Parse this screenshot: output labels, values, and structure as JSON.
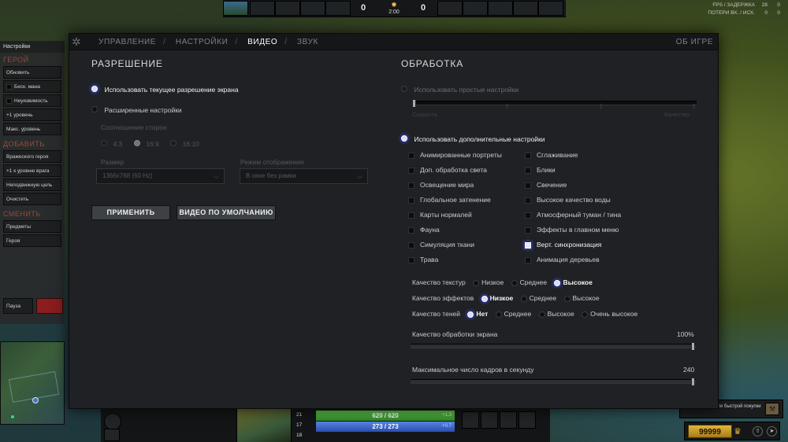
{
  "hud": {
    "score_radiant": "0",
    "score_dire": "0",
    "clock": "2:00",
    "fps_label": "FPS / ЗАДЕРЖКА",
    "fps_value": "28",
    "fps_latency": "0",
    "loss_label": "ПОТЕРИ ВХ. / ИСХ.",
    "loss_in": "0",
    "loss_out": "0",
    "hp": "620 / 620",
    "hp_regen": "+1.3",
    "mana": "273 / 273",
    "mana_regen": "+0.7",
    "attr_str": "21",
    "attr_agi": "17",
    "attr_int": "18",
    "gold": "99999",
    "quickbuy_text": "…те предмет для быстрой покупки"
  },
  "cheats": {
    "title": "Настройки",
    "hero_section": "ГЕРОЙ",
    "hero_buttons": [
      "Обновить",
      "Беск. мана",
      "Неуязвимость",
      "+1 уровень",
      "Макс. уровень"
    ],
    "add_section": "ДОБАВИТЬ",
    "add_buttons": [
      "Вражеского героя",
      "+1 к уровню врага",
      "Неподвижную цель",
      "Очистить"
    ],
    "change_section": "СМЕНИТЬ",
    "change_buttons": [
      "Предметы",
      "Героя"
    ],
    "pause": "Пауза"
  },
  "dialog": {
    "tabs": [
      "УПРАВЛЕНИЕ",
      "НАСТРОЙКИ",
      "ВИДЕО",
      "ЗВУК"
    ],
    "active_tab": "ВИДЕО",
    "about": "ОБ ИГРЕ",
    "resolution": {
      "title": "РАЗРЕШЕНИЕ",
      "use_current": "Использовать текущее разрешение экрана",
      "advanced": "Расширенные настройки",
      "aspect_label": "Соотношение сторон",
      "aspect_options": [
        "4:3",
        "16:9",
        "16:10"
      ],
      "aspect_selected": "16:9",
      "size_label": "Размер",
      "size_value": "1366x768 (60 Hz)",
      "mode_label": "Режим отображения",
      "mode_value": "В окне без рамки",
      "apply": "ПРИМЕНИТЬ",
      "default": "ВИДЕО ПО УМОЛЧАНИЮ"
    },
    "rendering": {
      "title": "ОБРАБОТКА",
      "simple": "Использовать простые настройки",
      "speed": "Скорость",
      "quality": "Качество",
      "advanced": "Использовать дополнительные настройки",
      "options_left": [
        {
          "label": "Анимированные портреты",
          "checked": false
        },
        {
          "label": "Доп. обработка света",
          "checked": false
        },
        {
          "label": "Освещение мира",
          "checked": false
        },
        {
          "label": "Глобальное затенение",
          "checked": false
        },
        {
          "label": "Карты нормалей",
          "checked": false
        },
        {
          "label": "Фауна",
          "checked": false
        },
        {
          "label": "Симуляция ткани",
          "checked": false
        },
        {
          "label": "Трава",
          "checked": false
        }
      ],
      "options_right": [
        {
          "label": "Сглаживание",
          "checked": false
        },
        {
          "label": "Блики",
          "checked": false
        },
        {
          "label": "Свечение",
          "checked": false
        },
        {
          "label": "Высокое качество воды",
          "checked": false
        },
        {
          "label": "Атмосферный туман / тина",
          "checked": false
        },
        {
          "label": "Эффекты в главном меню",
          "checked": false
        },
        {
          "label": "Верт. синхронизация",
          "checked": true
        },
        {
          "label": "Анимация деревьев",
          "checked": false
        }
      ],
      "texture_label": "Качество текстур",
      "texture_options": [
        "Низкое",
        "Среднее",
        "Высокое"
      ],
      "texture_selected": "Высокое",
      "effects_label": "Качество эффектов",
      "effects_options": [
        "Низкое",
        "Среднее",
        "Высокое"
      ],
      "effects_selected": "Низкое",
      "shadows_label": "Качество теней",
      "shadows_options": [
        "Нет",
        "Среднее",
        "Высокое",
        "Очень высокое"
      ],
      "shadows_selected": "Нет",
      "screen_quality_label": "Качество обработки экрана",
      "screen_quality_value": "100%",
      "screen_quality_fraction": 1.0,
      "max_fps_label": "Максимальное число кадров в секунду",
      "max_fps_value": "240",
      "max_fps_fraction": 1.0
    }
  }
}
